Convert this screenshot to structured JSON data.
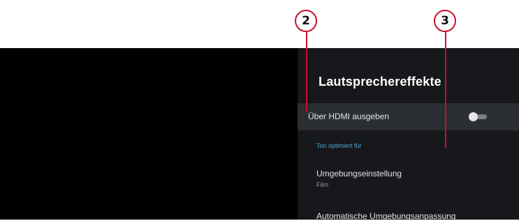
{
  "panel": {
    "title": "Lautsprechereffekte",
    "items": {
      "hdmi": {
        "label": "Über HDMI ausgeben",
        "toggle_on": false
      },
      "section_header": "Ton optimiert für",
      "umgebung": {
        "label": "Umgebungseinstellung",
        "value": "Film"
      },
      "auto": {
        "label": "Automatische Umgebungsanpassung"
      }
    }
  },
  "callouts": [
    {
      "number": "2"
    },
    {
      "number": "3"
    }
  ],
  "colors": {
    "accent": "#4fa8d8",
    "callout": "#c8102e",
    "panel_bg": "#16181b",
    "highlight_row": "#2b2e32"
  }
}
